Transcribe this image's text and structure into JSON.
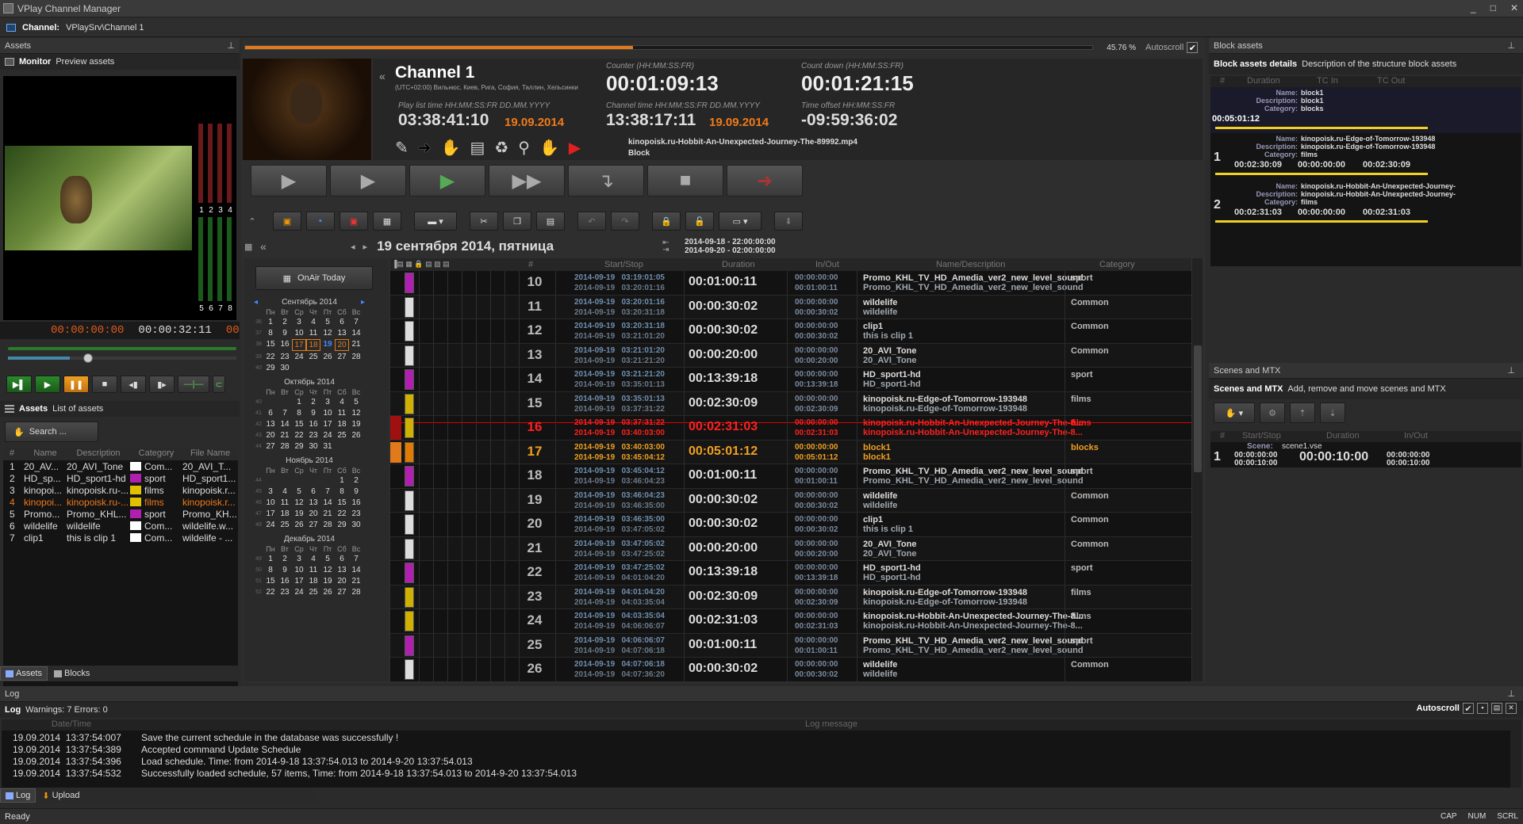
{
  "window": {
    "title": "VPlay Channel Manager",
    "controls": [
      "_",
      "□",
      "✕"
    ]
  },
  "channel_bar": {
    "label": "Channel:",
    "value": "VPlaySrv\\Channel 1"
  },
  "assets_panel": {
    "title": "Assets",
    "pin": "⊥",
    "monitor": {
      "title": "Monitor",
      "desc": "Preview assets",
      "timecode_in": "00:00:00:00",
      "timecode_out": "00:00:32:11",
      "timecode_extra": "00:0",
      "meter_top": [
        "1",
        "2",
        "3",
        "4"
      ],
      "meter_bottom": [
        "5",
        "6",
        "7",
        "8"
      ]
    },
    "list": {
      "title": "Assets",
      "desc": "List of assets",
      "search": "Search ...",
      "headers": [
        "#",
        "Name",
        "Description",
        "Category",
        "File Name"
      ],
      "rows": [
        {
          "n": "1",
          "name": "20_AV...",
          "desc": "20_AVI_Tone",
          "cat": "Com...",
          "file": "20_AVI_T...",
          "color": "#ffffff",
          "hl": false
        },
        {
          "n": "2",
          "name": "HD_sp...",
          "desc": "HD_sport1-hd",
          "cat": "sport",
          "file": "HD_sport1...",
          "color": "#b01fb0",
          "hl": false
        },
        {
          "n": "3",
          "name": "kinopoi...",
          "desc": "kinopoisk.ru-...",
          "cat": "films",
          "file": "kinopoisk.r...",
          "color": "#e0c000",
          "hl": false
        },
        {
          "n": "4",
          "name": "kinopoi...",
          "desc": "kinopoisk.ru-...",
          "cat": "films",
          "file": "kinopoisk.r...",
          "color": "#e0c000",
          "hl": true
        },
        {
          "n": "5",
          "name": "Promo...",
          "desc": "Promo_KHL...",
          "cat": "sport",
          "file": "Promo_KH...",
          "color": "#b01fb0",
          "hl": false
        },
        {
          "n": "6",
          "name": "wildelife",
          "desc": "wildelife",
          "cat": "Com...",
          "file": "wildelife.w...",
          "color": "#ffffff",
          "hl": false
        },
        {
          "n": "7",
          "name": "clip1",
          "desc": "this is clip 1",
          "cat": "Com...",
          "file": "wildelife - ...",
          "color": "#ffffff",
          "hl": false
        }
      ]
    },
    "tabs": [
      "Assets",
      "Blocks"
    ]
  },
  "channel": {
    "progress_pct": "45.76 %",
    "progress_value": 0.4576,
    "autoscroll": "Autoscroll",
    "name": "Channel 1",
    "tz": "(UTC+02:00) Вильнюс, Киев, Рига, София, Таллин, Хельсинки",
    "counter_label": "Counter (HH:MM:SS:FR)",
    "counter": "00:01:09:13",
    "countdown_label": "Count down (HH:MM:SS:FR)",
    "countdown": "00:01:21:15",
    "pl_time_label": "Play list time HH:MM:SS:FR  DD.MM.YYYY",
    "pl_time": "03:38:41:10",
    "pl_date": "19.09.2014",
    "ch_time_label": "Channel time HH:MM:SS:FR  DD.MM.YYYY",
    "ch_time": "13:38:17:11",
    "ch_date": "19.09.2014",
    "offset_label": "Time offset HH:MM:SS:FR",
    "offset": "-09:59:36:02",
    "current_file": "kinopoisk.ru-Hobbit-An-Unexpected-Journey-The-89992.mp4",
    "current_block": "Block"
  },
  "schedule": {
    "date_title": "19 сентября 2014, пятница",
    "range_from": "2014-09-18 - 22:00:00:00",
    "range_to": "2014-09-20 - 02:00:00:00",
    "onair_today": "OnAir Today",
    "headers": {
      "num": "#",
      "startstop": "Start/Stop",
      "duration": "Duration",
      "inout": "In/Out",
      "name": "Name/Description",
      "category": "Category"
    },
    "rows": [
      {
        "n": "10",
        "start": "2014-09-19   03:19:01:05",
        "stop": "2014-09-19   03:20:01:16",
        "dur": "00:01:00:11",
        "in": "00:00:00:00",
        "out": "00:01:00:11",
        "name": "Promo_KHL_TV_HD_Amedia_ver2_new_level_sound",
        "desc": "Promo_KHL_TV_HD_Amedia_ver2_new_level_sound",
        "cat": "sport",
        "color": "#b01fb0",
        "st": "n"
      },
      {
        "n": "11",
        "start": "2014-09-19   03:20:01:16",
        "stop": "2014-09-19   03:20:31:18",
        "dur": "00:00:30:02",
        "in": "00:00:00:00",
        "out": "00:00:30:02",
        "name": "wildelife",
        "desc": "wildelife",
        "cat": "Common",
        "color": "#dddddd",
        "st": "n"
      },
      {
        "n": "12",
        "start": "2014-09-19   03:20:31:18",
        "stop": "2014-09-19   03:21:01:20",
        "dur": "00:00:30:02",
        "in": "00:00:00:00",
        "out": "00:00:30:02",
        "name": "clip1",
        "desc": "this is clip 1",
        "cat": "Common",
        "color": "#dddddd",
        "st": "n"
      },
      {
        "n": "13",
        "start": "2014-09-19   03:21:01:20",
        "stop": "2014-09-19   03:21:21:20",
        "dur": "00:00:20:00",
        "in": "00:00:00:00",
        "out": "00:00:20:00",
        "name": "20_AVI_Tone",
        "desc": "20_AVI_Tone",
        "cat": "Common",
        "color": "#dddddd",
        "st": "n"
      },
      {
        "n": "14",
        "start": "2014-09-19   03:21:21:20",
        "stop": "2014-09-19   03:35:01:13",
        "dur": "00:13:39:18",
        "in": "00:00:00:00",
        "out": "00:13:39:18",
        "name": "HD_sport1-hd",
        "desc": "HD_sport1-hd",
        "cat": "sport",
        "color": "#b01fb0",
        "st": "n"
      },
      {
        "n": "15",
        "start": "2014-09-19   03:35:01:13",
        "stop": "2014-09-19   03:37:31:22",
        "dur": "00:02:30:09",
        "in": "00:00:00:00",
        "out": "00:02:30:09",
        "name": "kinopoisk.ru-Edge-of-Tomorrow-193948",
        "desc": "kinopoisk.ru-Edge-of-Tomorrow-193948",
        "cat": "films",
        "color": "#d0b000",
        "st": "n"
      },
      {
        "n": "16",
        "start": "2014-09-19   03:37:31:22",
        "stop": "2014-09-19   03:40:03:00",
        "dur": "00:02:31:03",
        "in": "00:00:00:00",
        "out": "00:02:31:03",
        "name": "kinopoisk.ru-Hobbit-An-Unexpected-Journey-The-8...",
        "desc": "kinopoisk.ru-Hobbit-An-Unexpected-Journey-The-8...",
        "cat": "films",
        "color": "#d0b000",
        "st": "air"
      },
      {
        "n": "17",
        "start": "2014-09-19   03:40:03:00",
        "stop": "2014-09-19   03:45:04:12",
        "dur": "00:05:01:12",
        "in": "00:00:00:00",
        "out": "00:05:01:12",
        "name": "block1",
        "desc": "block1",
        "cat": "blocks",
        "color": "#e07a00",
        "st": "blk"
      },
      {
        "n": "18",
        "start": "2014-09-19   03:45:04:12",
        "stop": "2014-09-19   03:46:04:23",
        "dur": "00:01:00:11",
        "in": "00:00:00:00",
        "out": "00:01:00:11",
        "name": "Promo_KHL_TV_HD_Amedia_ver2_new_level_sound",
        "desc": "Promo_KHL_TV_HD_Amedia_ver2_new_level_sound",
        "cat": "sport",
        "color": "#b01fb0",
        "st": "n"
      },
      {
        "n": "19",
        "start": "2014-09-19   03:46:04:23",
        "stop": "2014-09-19   03:46:35:00",
        "dur": "00:00:30:02",
        "in": "00:00:00:00",
        "out": "00:00:30:02",
        "name": "wildelife",
        "desc": "wildelife",
        "cat": "Common",
        "color": "#dddddd",
        "st": "n"
      },
      {
        "n": "20",
        "start": "2014-09-19   03:46:35:00",
        "stop": "2014-09-19   03:47:05:02",
        "dur": "00:00:30:02",
        "in": "00:00:00:00",
        "out": "00:00:30:02",
        "name": "clip1",
        "desc": "this is clip 1",
        "cat": "Common",
        "color": "#dddddd",
        "st": "n"
      },
      {
        "n": "21",
        "start": "2014-09-19   03:47:05:02",
        "stop": "2014-09-19   03:47:25:02",
        "dur": "00:00:20:00",
        "in": "00:00:00:00",
        "out": "00:00:20:00",
        "name": "20_AVI_Tone",
        "desc": "20_AVI_Tone",
        "cat": "Common",
        "color": "#dddddd",
        "st": "n"
      },
      {
        "n": "22",
        "start": "2014-09-19   03:47:25:02",
        "stop": "2014-09-19   04:01:04:20",
        "dur": "00:13:39:18",
        "in": "00:00:00:00",
        "out": "00:13:39:18",
        "name": "HD_sport1-hd",
        "desc": "HD_sport1-hd",
        "cat": "sport",
        "color": "#b01fb0",
        "st": "n"
      },
      {
        "n": "23",
        "start": "2014-09-19   04:01:04:20",
        "stop": "2014-09-19   04:03:35:04",
        "dur": "00:02:30:09",
        "in": "00:00:00:00",
        "out": "00:02:30:09",
        "name": "kinopoisk.ru-Edge-of-Tomorrow-193948",
        "desc": "kinopoisk.ru-Edge-of-Tomorrow-193948",
        "cat": "films",
        "color": "#d0b000",
        "st": "n"
      },
      {
        "n": "24",
        "start": "2014-09-19   04:03:35:04",
        "stop": "2014-09-19   04:06:06:07",
        "dur": "00:02:31:03",
        "in": "00:00:00:00",
        "out": "00:02:31:03",
        "name": "kinopoisk.ru-Hobbit-An-Unexpected-Journey-The-8...",
        "desc": "kinopoisk.ru-Hobbit-An-Unexpected-Journey-The-8...",
        "cat": "films",
        "color": "#d0b000",
        "st": "n"
      },
      {
        "n": "25",
        "start": "2014-09-19   04:06:06:07",
        "stop": "2014-09-19   04:07:06:18",
        "dur": "00:01:00:11",
        "in": "00:00:00:00",
        "out": "00:01:00:11",
        "name": "Promo_KHL_TV_HD_Amedia_ver2_new_level_sound",
        "desc": "Promo_KHL_TV_HD_Amedia_ver2_new_level_sound",
        "cat": "sport",
        "color": "#b01fb0",
        "st": "n"
      },
      {
        "n": "26",
        "start": "2014-09-19   04:07:06:18",
        "stop": "2014-09-19   04:07:36:20",
        "dur": "00:00:30:02",
        "in": "00:00:00:00",
        "out": "00:00:30:02",
        "name": "wildelife",
        "desc": "wildelife",
        "cat": "Common",
        "color": "#dddddd",
        "st": "n"
      }
    ]
  },
  "calendars": [
    {
      "title": "Сентябрь 2014",
      "weeks": [
        [
          "36",
          "1",
          "2",
          "3",
          "4",
          "5",
          "6",
          "7"
        ],
        [
          "37",
          "8",
          "9",
          "10",
          "11",
          "12",
          "13",
          "14"
        ],
        [
          "38",
          "15",
          "16",
          "17",
          "18",
          "19",
          "20",
          "21"
        ],
        [
          "39",
          "22",
          "23",
          "24",
          "25",
          "26",
          "27",
          "28"
        ],
        [
          "40",
          "29",
          "30",
          "",
          "",
          "",
          "",
          ""
        ]
      ]
    },
    {
      "title": "Октябрь 2014",
      "weeks": [
        [
          "40",
          "",
          "",
          "1",
          "2",
          "3",
          "4",
          "5"
        ],
        [
          "41",
          "6",
          "7",
          "8",
          "9",
          "10",
          "11",
          "12"
        ],
        [
          "42",
          "13",
          "14",
          "15",
          "16",
          "17",
          "18",
          "19"
        ],
        [
          "43",
          "20",
          "21",
          "22",
          "23",
          "24",
          "25",
          "26"
        ],
        [
          "44",
          "27",
          "28",
          "29",
          "30",
          "31",
          "",
          ""
        ]
      ]
    },
    {
      "title": "Ноябрь 2014",
      "weeks": [
        [
          "44",
          "",
          "",
          "",
          "",
          "",
          "1",
          "2"
        ],
        [
          "45",
          "3",
          "4",
          "5",
          "6",
          "7",
          "8",
          "9"
        ],
        [
          "46",
          "10",
          "11",
          "12",
          "13",
          "14",
          "15",
          "16"
        ],
        [
          "47",
          "17",
          "18",
          "19",
          "20",
          "21",
          "22",
          "23"
        ],
        [
          "48",
          "24",
          "25",
          "26",
          "27",
          "28",
          "29",
          "30"
        ]
      ]
    },
    {
      "title": "Декабрь 2014",
      "weeks": [
        [
          "49",
          "1",
          "2",
          "3",
          "4",
          "5",
          "6",
          "7"
        ],
        [
          "50",
          "8",
          "9",
          "10",
          "11",
          "12",
          "13",
          "14"
        ],
        [
          "51",
          "15",
          "16",
          "17",
          "18",
          "19",
          "20",
          "21"
        ],
        [
          "52",
          "22",
          "23",
          "24",
          "25",
          "26",
          "27",
          "28"
        ]
      ]
    }
  ],
  "weekdays": [
    "Пн",
    "Вт",
    "Ср",
    "Чт",
    "Пт",
    "Сб",
    "Вс"
  ],
  "block_assets": {
    "title": "Block assets",
    "sub_title": "Block assets details",
    "sub_desc": "Description of the structure block assets",
    "headers": [
      "#",
      "Duration",
      "TC In",
      "TC Out"
    ],
    "block": {
      "name": "block1",
      "description": "block1",
      "category": "blocks",
      "duration": "00:05:01:12"
    },
    "items": [
      {
        "n": "1",
        "name": "kinopoisk.ru-Edge-of-Tomorrow-193948",
        "description": "kinopoisk.ru-Edge-of-Tomorrow-193948",
        "category": "films",
        "dur": "00:02:30:09",
        "in": "00:00:00:00",
        "out": "00:02:30:09"
      },
      {
        "n": "2",
        "name": "kinopoisk.ru-Hobbit-An-Unexpected-Journey-",
        "description": "kinopoisk.ru-Hobbit-An-Unexpected-Journey-",
        "category": "films",
        "dur": "00:02:31:03",
        "in": "00:00:00:00",
        "out": "00:02:31:03"
      }
    ],
    "labels": {
      "name": "Name:",
      "description": "Description:",
      "category": "Category:"
    }
  },
  "scenes": {
    "title": "Scenes and MTX",
    "sub_title": "Scenes and MTX",
    "sub_desc": "Add, remove and move scenes and MTX",
    "headers": [
      "#",
      "Start/Stop",
      "Duration",
      "In/Out"
    ],
    "row": {
      "n": "1",
      "scene_label": "Scene:",
      "scene": "scene1.vse",
      "start": "00:00:00:00",
      "stop": "00:00:10:00",
      "dur": "00:00:10:00",
      "in": "00:00:00:00",
      "out": "00:00:10:00"
    }
  },
  "log": {
    "title": "Log",
    "sub_title": "Log",
    "stats": "Warnings: 7  Errors: 0",
    "autoscroll": "Autoscroll",
    "headers": [
      "Date/Time",
      "Log message"
    ],
    "rows": [
      {
        "t": "19.09.2014  13:37:54:007",
        "m": "Save the current schedule in the database was successfully !"
      },
      {
        "t": "19.09.2014  13:37:54:389",
        "m": "Accepted command Update Schedule"
      },
      {
        "t": "19.09.2014  13:37:54:396",
        "m": "Load schedule. Time: from 2014-9-18 13:37:54.013 to 2014-9-20 13:37:54.013"
      },
      {
        "t": "19.09.2014  13:37:54:532",
        "m": "Successfully loaded schedule, 57 items, Time: from 2014-9-18 13:37:54.013 to 2014-9-20 13:37:54.013"
      }
    ],
    "tabs": [
      "Log",
      "Upload"
    ]
  },
  "status": {
    "text": "Ready",
    "indicators": [
      "CAP",
      "NUM",
      "SCRL"
    ]
  }
}
